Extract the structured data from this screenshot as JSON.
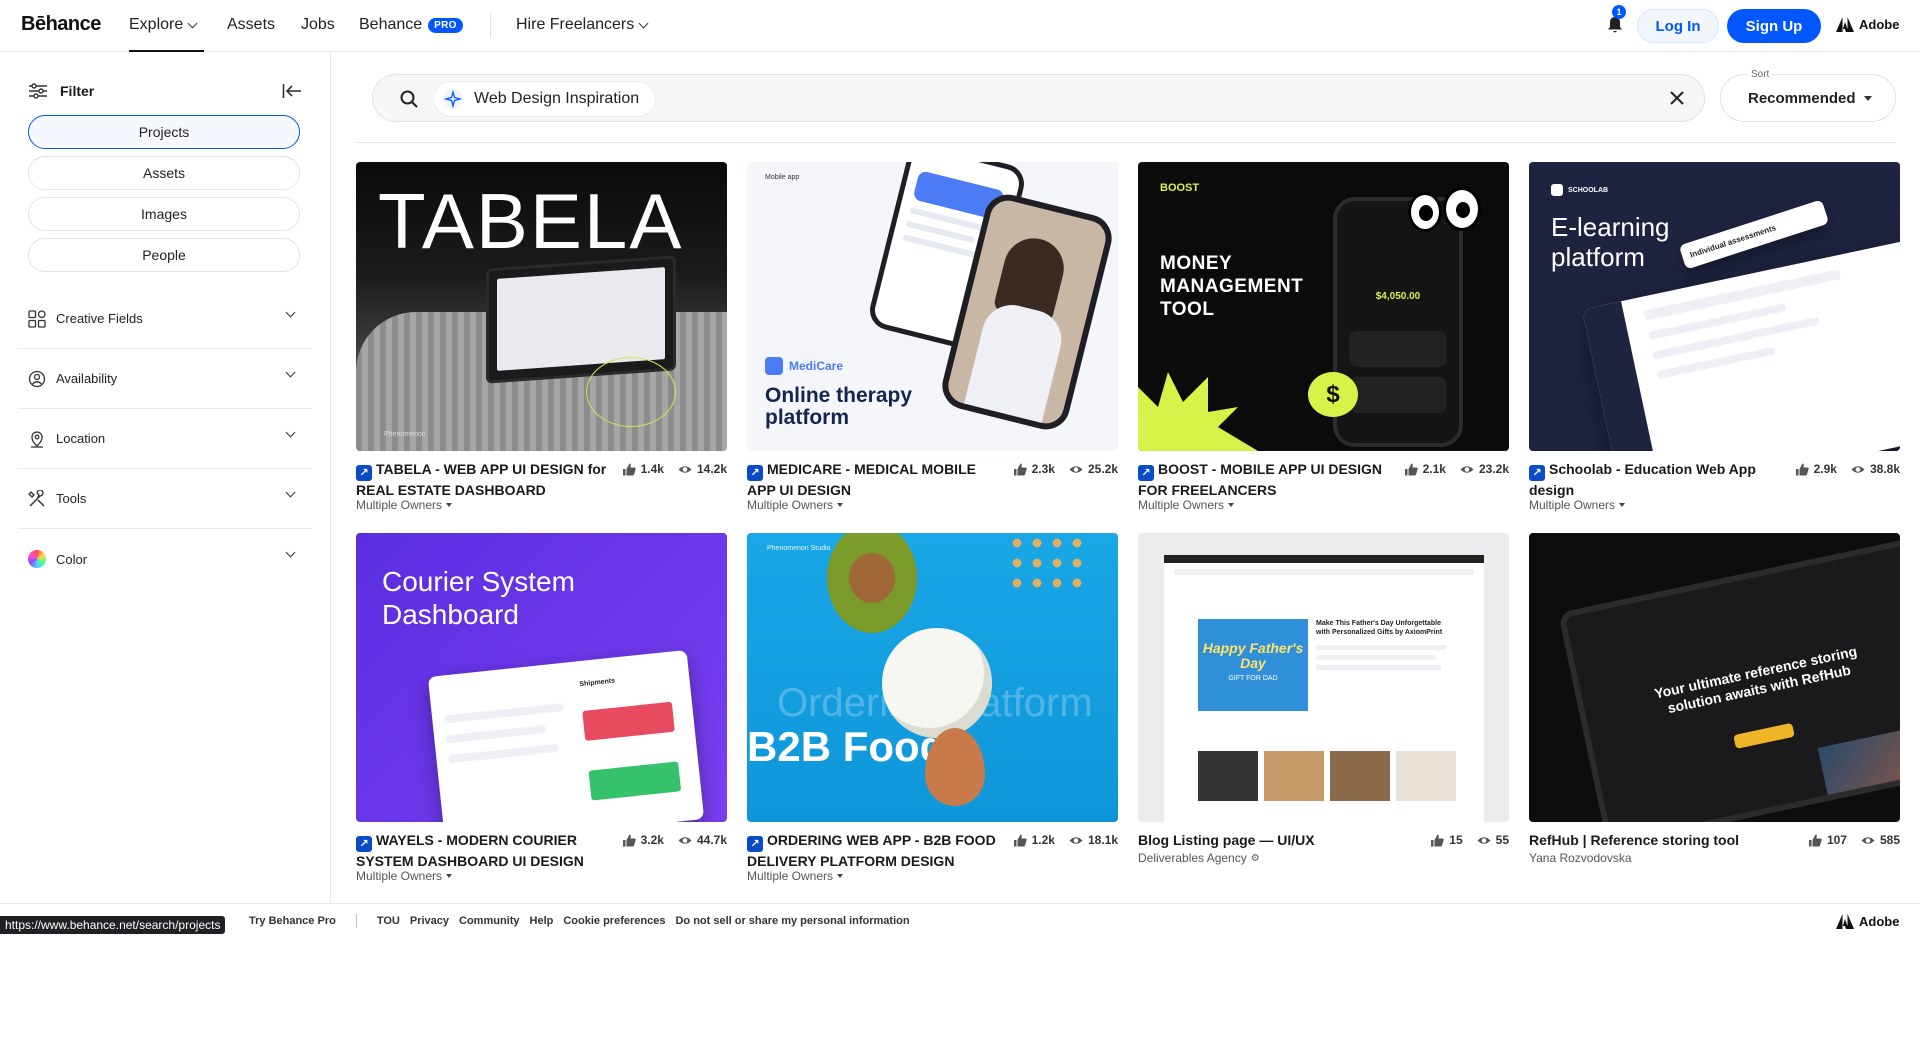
{
  "brand": {
    "logo": "Bēhance",
    "adobe": "Adobe"
  },
  "nav": {
    "explore": "Explore",
    "assets": "Assets",
    "jobs": "Jobs",
    "behance": "Behance",
    "pro": "PRO",
    "hire": "Hire Freelancers",
    "notifications_count": "1",
    "login": "Log In",
    "signup": "Sign Up"
  },
  "sidebar": {
    "filter": "Filter",
    "tabs": [
      "Projects",
      "Assets",
      "Images",
      "People"
    ],
    "active_tab": "Projects",
    "facets": [
      "Creative Fields",
      "Availability",
      "Location",
      "Tools",
      "Color"
    ]
  },
  "search": {
    "query": "Web Design Inspiration",
    "sort_label": "Sort",
    "sort_value": "Recommended"
  },
  "projects": [
    {
      "title_l1": "TABELA - WEB APP UI DESIGN for",
      "title_l2": "REAL ESTATE DASHBOARD",
      "owner": "Multiple Owners",
      "likes": "1.4k",
      "views": "14.2k",
      "ext": true
    },
    {
      "title_l1": "MEDICARE - MEDICAL MOBILE",
      "title_l2": "APP UI DESIGN",
      "owner": "Multiple Owners",
      "likes": "2.3k",
      "views": "25.2k",
      "ext": true
    },
    {
      "title_l1": "BOOST - MOBILE APP UI DESIGN",
      "title_l2": "FOR FREELANCERS",
      "owner": "Multiple Owners",
      "likes": "2.1k",
      "views": "23.2k",
      "ext": true
    },
    {
      "title_l1": "Schoolab - Education Web App",
      "title_l2": "design",
      "owner": "Multiple Owners",
      "likes": "2.9k",
      "views": "38.8k",
      "ext": true
    },
    {
      "title_l1": "WAYELS - MODERN COURIER",
      "title_l2": "SYSTEM DASHBOARD UI DESIGN",
      "owner": "Multiple Owners",
      "likes": "3.2k",
      "views": "44.7k",
      "ext": true
    },
    {
      "title_l1": "ORDERING WEB APP - B2B FOOD",
      "title_l2": "DELIVERY PLATFORM DESIGN",
      "owner": "Multiple Owners",
      "likes": "1.2k",
      "views": "18.1k",
      "ext": true
    },
    {
      "title_l1": "Blog Listing page — UI/UX",
      "title_l2": "",
      "owner": "Deliverables Agency",
      "likes": "15",
      "views": "55",
      "ext": false
    },
    {
      "title_l1": "RefHub | Reference storing tool",
      "title_l2": "",
      "owner": "Yana Rozvodovska",
      "likes": "107",
      "views": "585",
      "ext": false
    }
  ],
  "thumb_text": {
    "tabela": "TABELA",
    "tabela_small": "Phenomenon",
    "medicare_brand": "MediCare",
    "medicare_head": "Online therapy platform",
    "medicare_small": "Mobile app",
    "boost_brand": "BOOST",
    "boost_head": "MONEY MANAGEMENT TOOL",
    "boost_amount": "$4,050.00",
    "schoolab_brand": "SCHOOLAB",
    "schoolab_head": "E-learning platform",
    "schoolab_card": "Individual assessments",
    "courier_head": "Courier System Dashboard",
    "courier_small": "Shipments",
    "b2b_head": "B2B Food",
    "b2b_ghost": "Ordering Platform",
    "b2b_small": "Phenomenon Studio",
    "blog_head": "Make This Father's Day Unforgettable with Personalized Gifts by AxiomPrint",
    "blog_banner": "Happy Father's Day",
    "blog_banner_sub": "GIFT FOR DAD",
    "refhub_head": "Your ultimate reference storing solution awaits with RefHub"
  },
  "footer": {
    "url": "https://www.behance.net/search/projects",
    "links": [
      "Try Behance Pro",
      "TOU",
      "Privacy",
      "Community",
      "Help",
      "Cookie preferences",
      "Do not sell or share my personal information"
    ],
    "adobe": "Adobe"
  },
  "colors": {
    "accent": "#0057ff",
    "text": "#191919",
    "border": "#e8e8e8"
  }
}
